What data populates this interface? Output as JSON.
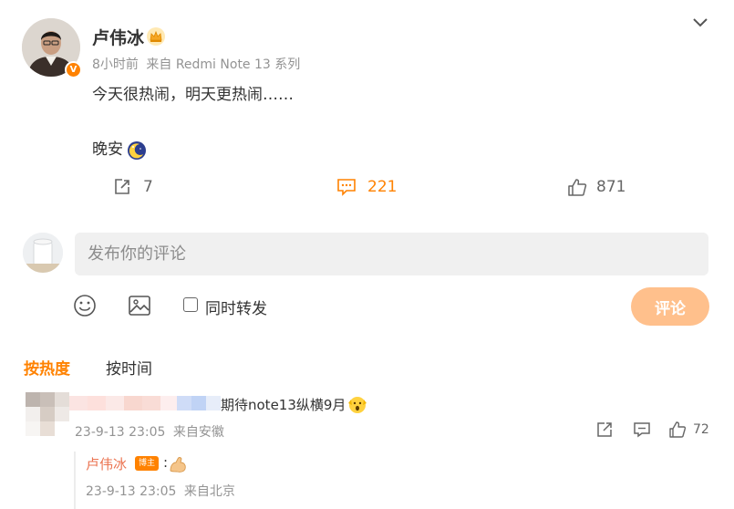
{
  "post": {
    "author": "卢伟冰",
    "time": "8小时前",
    "source": "来自 Redmi Note 13 系列",
    "text_line1": "今天很热闹，明天更热闹……",
    "text_line2": "晚安",
    "verified_badge": "V",
    "icons": [
      "crown-icon",
      "moon-emoji-icon",
      "chevron-down-icon"
    ],
    "colors": {
      "accent": "#ff8200",
      "meta": "#939393"
    }
  },
  "actions": {
    "repost_count": "7",
    "comment_count": "221",
    "like_count": "871"
  },
  "composer": {
    "placeholder": "发布你的评论",
    "repost_label": "同时转发",
    "submit_label": "评论",
    "icons": [
      "emoji-icon",
      "image-icon"
    ]
  },
  "sort": {
    "hot": "按热度",
    "time": "按时间"
  },
  "comments": [
    {
      "text": "期待note13纵横9月",
      "time": "23-9-13 23:05",
      "source": "来自安徽",
      "likes": "72",
      "reply": {
        "author": "卢伟冰",
        "badge": "博主",
        "colon": ":",
        "time": "23-9-13 23:05",
        "source": "来自北京"
      }
    }
  ]
}
